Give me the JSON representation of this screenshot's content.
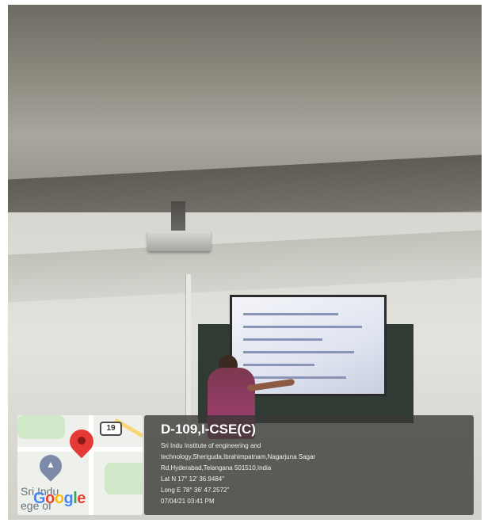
{
  "stamp": {
    "location_title": "D-109,I-CSE(C)",
    "address_lines": [
      "Sri Indu Institute of engineering and",
      "technology,Sheriguda,Ibrahimpatnam,Nagarjuna Sagar",
      "Rd,Hyderabad,Telangana 501510,India"
    ],
    "latitude": "Lat N 17° 12' 36.9484\"",
    "longitude": "Long E 78° 36' 47.2572\"",
    "datetime": "07/04/21 03:41 PM"
  },
  "map": {
    "road_shield": "19",
    "place_label_1": "Sri Indu",
    "place_label_2": "ege of",
    "google_letters": [
      "G",
      "o",
      "o",
      "g",
      "l",
      "e"
    ],
    "google_colors": [
      "#4285F4",
      "#EA4335",
      "#FBBC05",
      "#4285F4",
      "#34A853",
      "#EA4335"
    ],
    "pin_icon": "location-pin-icon",
    "school_icon": "graduation-cap-icon"
  }
}
